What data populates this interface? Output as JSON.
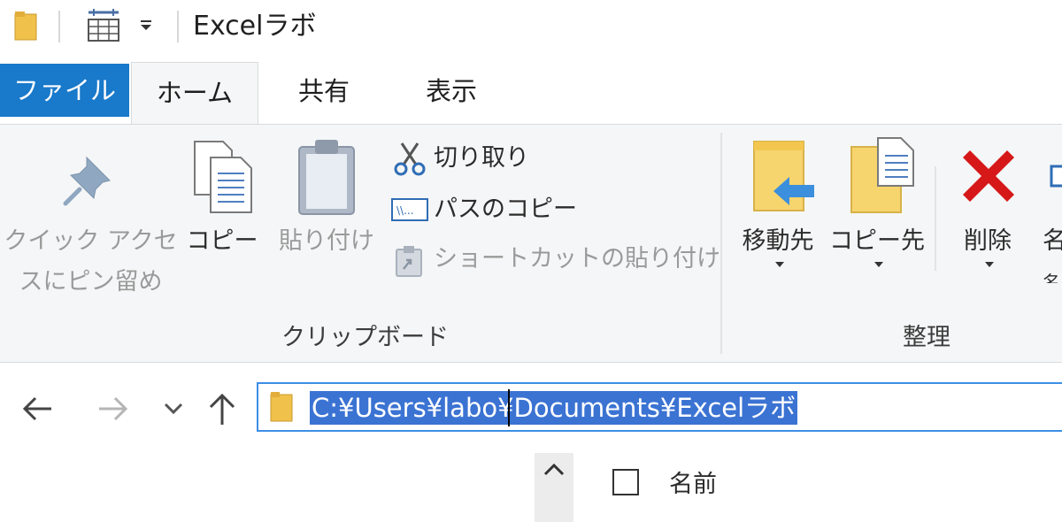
{
  "window": {
    "title": "Excelラボ"
  },
  "tabs": [
    {
      "label": "ファイル",
      "active": false
    },
    {
      "label": "ホーム",
      "active": true
    },
    {
      "label": "共有",
      "active": false
    },
    {
      "label": "表示",
      "active": false
    }
  ],
  "ribbon": {
    "clipboard": {
      "pin_label_line1": "クイック アクセ",
      "pin_label_line2": "スにピン留め",
      "copy_label": "コピー",
      "paste_label": "貼り付け",
      "cut_label": "切り取り",
      "copy_path_label": "パスのコピー",
      "paste_shortcut_label": "ショートカットの貼り付け",
      "group_title": "クリップボード"
    },
    "organize": {
      "move_to_label": "移動先",
      "copy_to_label": "コピー先",
      "delete_label": "削除",
      "rename_label_partial_line1": "名",
      "rename_label_partial_line2": "名",
      "group_title": "整理"
    }
  },
  "address_bar": {
    "path": "C:¥Users¥labo¥Documents¥Excelラボ"
  },
  "file_list": {
    "column_name": "名前"
  },
  "colors": {
    "file_tab": "#1979ca",
    "ribbon_bg": "#f5f6f7",
    "selection": "#3b73d3",
    "address_border": "#3d8ee6",
    "delete_x": "#d61818"
  }
}
